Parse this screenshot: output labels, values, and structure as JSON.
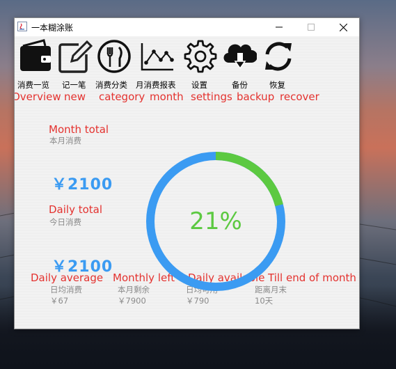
{
  "window": {
    "title": "一本糊涂账"
  },
  "toolbar": [
    {
      "zh": "消费一览",
      "en": "Overview",
      "icon": "wallet-icon"
    },
    {
      "zh": "记一笔",
      "en": "new",
      "icon": "edit-icon"
    },
    {
      "zh": "消费分类",
      "en": "category",
      "icon": "utensils-icon"
    },
    {
      "zh": "月消费报表",
      "en": "month",
      "icon": "line-chart-icon"
    },
    {
      "zh": "设置",
      "en": "settings",
      "icon": "gear-icon"
    },
    {
      "zh": "备份",
      "en": "backup",
      "icon": "cloud-download-icon"
    },
    {
      "zh": "恢复",
      "en": "recover",
      "icon": "refresh-icon"
    }
  ],
  "stats": {
    "month_total": {
      "en": "Month total",
      "zh": "本月消费",
      "value": "￥2100"
    },
    "daily_total": {
      "en": "Daily total",
      "zh": "今日消费",
      "value": "￥2100"
    },
    "daily_average": {
      "en": "Daily average",
      "zh": "日均消费",
      "value": "￥67"
    },
    "monthly_left": {
      "en": "Monthly left",
      "zh": "本月剩余",
      "value": "￥7900"
    },
    "daily_available": {
      "en": "Daily available",
      "zh": "日均可用",
      "value": "￥790"
    },
    "till_end": {
      "en": "Till end of month",
      "zh": "距离月末",
      "value": "10天"
    }
  },
  "progress": {
    "label": "21%",
    "fraction": 0.21
  },
  "colors": {
    "accent_red": "#e4322f",
    "value_blue": "#3b9bf2",
    "progress_green": "#5cc941",
    "ring_blue": "#3b9bf2"
  }
}
